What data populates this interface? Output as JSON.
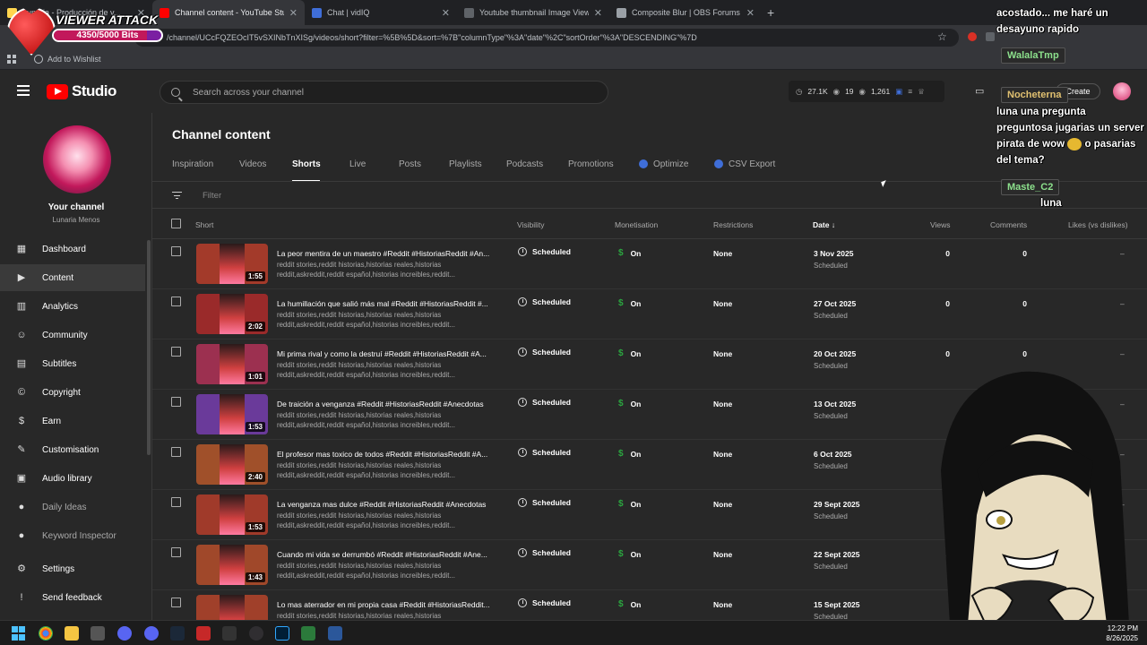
{
  "browser": {
    "tabs": [
      {
        "title": "Lunaria - Producción de v...",
        "color": "#ffd54f",
        "active": false
      },
      {
        "title": "Channel content - YouTube Stu...",
        "color": "#ff0000",
        "active": true
      },
      {
        "title": "Chat | vidIQ",
        "color": "#3f6ed8",
        "active": false
      },
      {
        "title": "Youtube thumbnail Image View...",
        "color": "#5f6368",
        "active": false
      },
      {
        "title": "Composite Blur | OBS Forums",
        "color": "#9aa0a6",
        "active": false
      }
    ],
    "url": "/channel/UCcFQZEOcIT5vSXINbTnXISg/videos/short?filter=%5B%5D&sort=%7B\"columnType\"%3A\"date\"%2C\"sortOrder\"%3A\"DESCENDING\"%7D",
    "bookmark": "Add to Wishlist"
  },
  "overlay": {
    "title": "VIEWER ATTACK",
    "bits": "4350/5000 Bits",
    "progress": 0.87
  },
  "studio": {
    "logo": "Studio",
    "search_placeholder": "Search across your channel",
    "stats": {
      "views": "27.1K",
      "watch": "19",
      "subs": "1,261"
    },
    "create": "Create"
  },
  "sidebar": {
    "channel_label": "Your channel",
    "channel_name": "Lunaria Menos",
    "items": [
      {
        "label": "Dashboard",
        "icon": "▦",
        "active": false,
        "dim": false
      },
      {
        "label": "Content",
        "icon": "▶",
        "active": true,
        "dim": false
      },
      {
        "label": "Analytics",
        "icon": "▥",
        "active": false,
        "dim": false
      },
      {
        "label": "Community",
        "icon": "☺",
        "active": false,
        "dim": false
      },
      {
        "label": "Subtitles",
        "icon": "▤",
        "active": false,
        "dim": false
      },
      {
        "label": "Copyright",
        "icon": "©",
        "active": false,
        "dim": false
      },
      {
        "label": "Earn",
        "icon": "$",
        "active": false,
        "dim": false
      },
      {
        "label": "Customisation",
        "icon": "✎",
        "active": false,
        "dim": false
      },
      {
        "label": "Audio library",
        "icon": "▣",
        "active": false,
        "dim": false
      },
      {
        "label": "Daily Ideas",
        "icon": "●",
        "active": false,
        "dim": true
      },
      {
        "label": "Keyword Inspector",
        "icon": "●",
        "active": false,
        "dim": true
      },
      {
        "label": "Settings",
        "icon": "⚙",
        "active": false,
        "dim": false
      },
      {
        "label": "Send feedback",
        "icon": "!",
        "active": false,
        "dim": false
      }
    ]
  },
  "main": {
    "title": "Channel content",
    "tabs": [
      "Inspiration",
      "Videos",
      "Shorts",
      "Live",
      "Posts",
      "Playlists",
      "Podcasts",
      "Promotions",
      "Optimize",
      "CSV Export"
    ],
    "active_tab": "Shorts",
    "filter_placeholder": "Filter",
    "columns": {
      "short": "Short",
      "visibility": "Visibility",
      "monetisation": "Monetisation",
      "restrictions": "Restrictions",
      "date": "Date",
      "views": "Views",
      "comments": "Comments",
      "likes": "Likes (vs dislikes)"
    },
    "rows": [
      {
        "title": "La peor mentira de un maestro #Reddit #HistoriasReddit #An...",
        "desc1": "reddit stories,reddit historias,historias reales,historias",
        "desc2": "reddit,askreddit,reddit español,historias increibles,reddit...",
        "duration": "1:55",
        "visibility": "Scheduled",
        "monetisation": "On",
        "restrictions": "None",
        "date": "3 Nov 2025",
        "date_sub": "Scheduled",
        "views": "0",
        "comments": "0",
        "likes": "–",
        "thumb": "#a33a2a"
      },
      {
        "title": "La humillación que salió más mal #Reddit #HistoriasReddit #...",
        "desc1": "reddit stories,reddit historias,historias reales,historias",
        "desc2": "reddit,askreddit,reddit español,historias increibles,reddit...",
        "duration": "2:02",
        "visibility": "Scheduled",
        "monetisation": "On",
        "restrictions": "None",
        "date": "27 Oct 2025",
        "date_sub": "Scheduled",
        "views": "0",
        "comments": "0",
        "likes": "–",
        "thumb": "#9a2a2a"
      },
      {
        "title": "Mi prima rival y como la destruí #Reddit #HistoriasReddit #A...",
        "desc1": "reddit stories,reddit historias,historias reales,historias",
        "desc2": "reddit,askreddit,reddit español,historias increibles,reddit...",
        "duration": "1:01",
        "visibility": "Scheduled",
        "monetisation": "On",
        "restrictions": "None",
        "date": "20 Oct 2025",
        "date_sub": "Scheduled",
        "views": "0",
        "comments": "0",
        "likes": "–",
        "thumb": "#9c3050"
      },
      {
        "title": "De traición a venganza #Reddit #HistoriasReddit #Anecdotas",
        "desc1": "reddit stories,reddit historias,historias reales,historias",
        "desc2": "reddit,askreddit,reddit español,historias increibles,reddit...",
        "duration": "1:53",
        "visibility": "Scheduled",
        "monetisation": "On",
        "restrictions": "None",
        "date": "13 Oct 2025",
        "date_sub": "Scheduled",
        "views": "",
        "comments": "",
        "likes": "–",
        "thumb": "#6a3a9a"
      },
      {
        "title": "El profesor mas toxico de todos #Reddit #HistoriasReddit #A...",
        "desc1": "reddit stories,reddit historias,historias reales,historias",
        "desc2": "reddit,askreddit,reddit español,historias increibles,reddit...",
        "duration": "2:40",
        "visibility": "Scheduled",
        "monetisation": "On",
        "restrictions": "None",
        "date": "6 Oct 2025",
        "date_sub": "Scheduled",
        "views": "",
        "comments": "",
        "likes": "–",
        "thumb": "#a0502a"
      },
      {
        "title": "La venganza mas dulce #Reddit #HistoriasReddit #Anecdotas",
        "desc1": "reddit stories,reddit historias,historias reales,historias",
        "desc2": "reddit,askreddit,reddit español,historias increibles,reddit...",
        "duration": "1:53",
        "visibility": "Scheduled",
        "monetisation": "On",
        "restrictions": "None",
        "date": "29 Sept 2025",
        "date_sub": "Scheduled",
        "views": "",
        "comments": "",
        "likes": "–",
        "thumb": "#a03a2a"
      },
      {
        "title": "Cuando mi vida se derrumbó #Reddit #HistoriasReddit #Ane...",
        "desc1": "reddit stories,reddit historias,historias reales,historias",
        "desc2": "reddit,askreddit,reddit español,historias increibles,reddit...",
        "duration": "1:43",
        "visibility": "Scheduled",
        "monetisation": "On",
        "restrictions": "None",
        "date": "22 Sept 2025",
        "date_sub": "Scheduled",
        "views": "0",
        "comments": "",
        "likes": "–",
        "thumb": "#a0482a"
      },
      {
        "title": "Lo mas aterrador en mi propia casa #Reddit #HistoriasReddit...",
        "desc1": "reddit stories,reddit historias,historias reales,historias",
        "desc2": "",
        "duration": "",
        "visibility": "Scheduled",
        "monetisation": "On",
        "restrictions": "None",
        "date": "15 Sept 2025",
        "date_sub": "Scheduled",
        "views": "",
        "comments": "",
        "likes": "–",
        "thumb": "#a0402a"
      }
    ]
  },
  "chat": [
    {
      "type": "msg",
      "text": "acostado... me haré un desayuno rapido"
    },
    {
      "type": "name",
      "text": "WalalaTmp"
    },
    {
      "type": "name",
      "text": "Nocheterna"
    },
    {
      "type": "msg",
      "text": "luna una pregunta preguntosa jugarias un server pirata de wow"
    },
    {
      "type": "msg",
      "text": "o pasarias del tema?"
    },
    {
      "type": "name",
      "text": "Maste_C2"
    },
    {
      "type": "msg",
      "text": "luna"
    }
  ],
  "taskbar": {
    "time": "12:22 PM",
    "date": "8/26/2025"
  }
}
